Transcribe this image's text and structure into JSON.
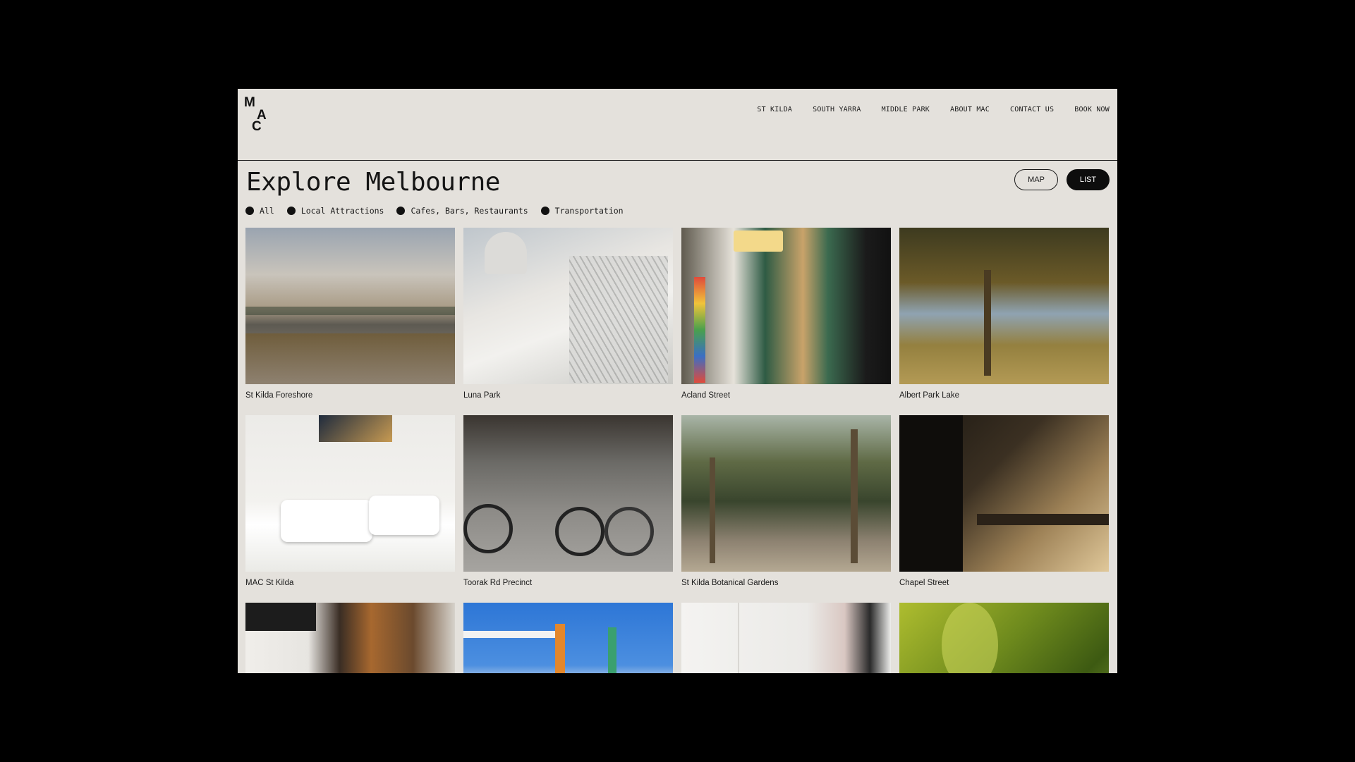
{
  "logo": {
    "l1": "M",
    "l2": "A",
    "l3": "C"
  },
  "nav": {
    "items": [
      {
        "label": "ST KILDA"
      },
      {
        "label": "SOUTH YARRA"
      },
      {
        "label": "MIDDLE PARK"
      },
      {
        "label": "ABOUT MAC"
      },
      {
        "label": "CONTACT US"
      },
      {
        "label": "BOOK NOW"
      }
    ]
  },
  "page": {
    "title": "Explore Melbourne"
  },
  "view_toggle": {
    "map_label": "MAP",
    "list_label": "LIST",
    "active": "LIST"
  },
  "filters": [
    {
      "label": "All"
    },
    {
      "label": "Local Attractions"
    },
    {
      "label": "Cafes, Bars, Restaurants"
    },
    {
      "label": "Transportation"
    }
  ],
  "places": [
    {
      "name": "St Kilda Foreshore"
    },
    {
      "name": "Luna Park"
    },
    {
      "name": "Acland Street"
    },
    {
      "name": "Albert Park Lake"
    },
    {
      "name": "MAC St Kilda"
    },
    {
      "name": "Toorak Rd Precinct"
    },
    {
      "name": "St Kilda Botanical Gardens"
    },
    {
      "name": "Chapel Street"
    },
    {
      "name": ""
    },
    {
      "name": ""
    },
    {
      "name": ""
    },
    {
      "name": ""
    }
  ],
  "colors": {
    "page_background": "#e4e1dc",
    "frame_background": "#000000",
    "text": "#1a1a1a",
    "active_button": "#0d0d0d"
  }
}
